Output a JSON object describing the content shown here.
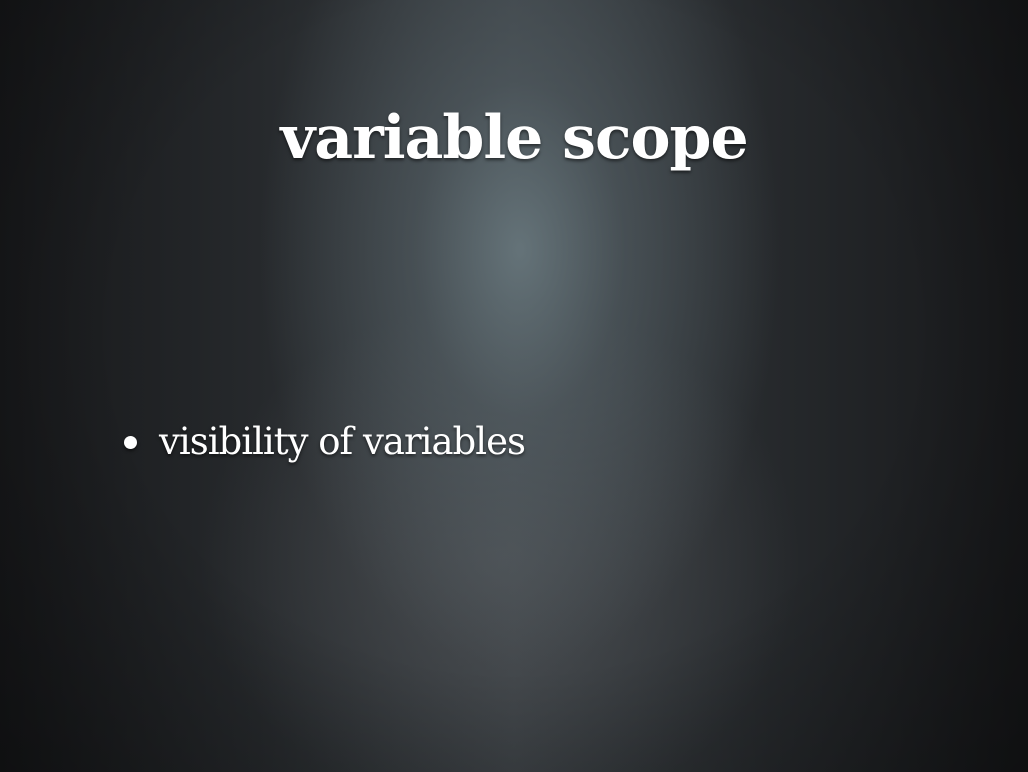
{
  "slide": {
    "title": "variable scope",
    "bullets": [
      {
        "text": "visibility of variables"
      }
    ]
  },
  "colors": {
    "text": "#ffffff",
    "background_dark": "#1c1d1f",
    "background_highlight": "#5f6e73"
  },
  "icons": {
    "bullet": "bullet-dot-icon"
  }
}
